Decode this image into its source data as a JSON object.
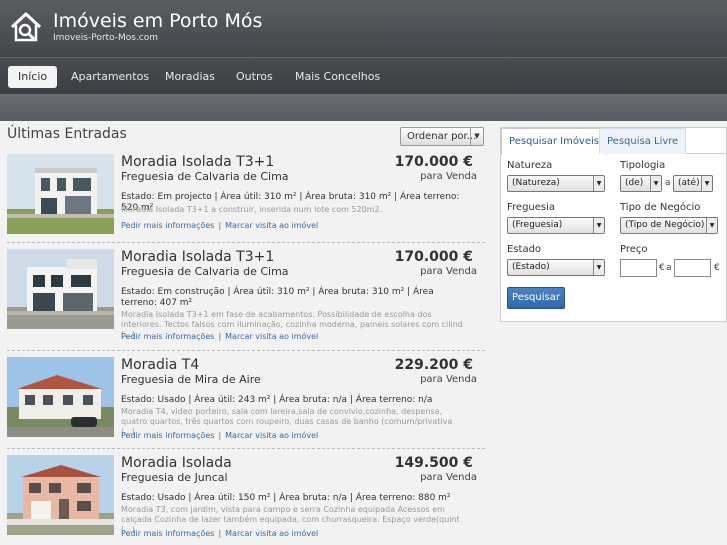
{
  "site": {
    "title": "Imóveis em Porto Mós",
    "subtitle": "Imoveis-Porto-Mos.com"
  },
  "nav": {
    "items": [
      "Início",
      "Apartamentos",
      "Moradias",
      "Outros",
      "Mais Concelhos"
    ]
  },
  "listing": {
    "title": "Últimas Entradas",
    "sort_label": "Ordenar por...",
    "items": [
      {
        "title": "Moradia Isolada  T3+1",
        "location": "Freguesia de Calvaria de Cima",
        "price": "170.000 €",
        "deal": "para Venda",
        "specs": "Estado: Em projecto  | Área útil: 310 m²  | Área bruta: 310 m²  | Área terreno: 520 m²",
        "desc": "Moradia Isolada T3+1 a construir, inserida num lote com 520m2.",
        "link_info": "Pedir mais informações",
        "link_visit": "Marcar visita ao imóvel"
      },
      {
        "title": "Moradia Isolada  T3+1",
        "location": "Freguesia de Calvaria de Cima",
        "price": "170.000 €",
        "deal": "para Venda",
        "specs": "Estado: Em construção  | Área útil: 310 m²  | Área bruta: 310 m²  | Área terreno: 407 m²",
        "desc": "Moradia Isolada T3+1 em fase de acabamentos. Possibilidade de escolha dos interiores. Tectos falsos com iluminação, cozinha moderna, paineis solares com cilind (...)",
        "link_info": "Pedir mais informações",
        "link_visit": "Marcar visita ao imóvel"
      },
      {
        "title": "Moradia  T4",
        "location": "Freguesia de Mira de Aire",
        "price": "229.200 €",
        "deal": "para Venda",
        "specs": "Estado: Usado  | Área útil: 243 m²  | Área bruta: n/a  | Área terreno: n/a",
        "desc": "Moradia T4, video porteiro, sala com lareira,sala de convivio,cozinha, despensa, quatro quartos, três quartos com roupeiro, duas casas de banho (comum/privativa (...)",
        "link_info": "Pedir mais informações",
        "link_visit": "Marcar visita ao imóvel"
      },
      {
        "title": "Moradia Isolada",
        "location": "Freguesia de Juncal",
        "price": "149.500 €",
        "deal": "para Venda",
        "specs": "Estado: Usado  | Área útil: 150 m²  | Área bruta: n/a  | Área terreno: 880 m²",
        "desc": "Moradia T3, com jardim, vista para campo e serra Cozinha equipada Acessos em calçada Cozinha de lazer também equipada, com churrasqueira. Espaço verde(quint (...)",
        "link_info": "Pedir mais informações",
        "link_visit": "Marcar visita ao imóvel"
      }
    ]
  },
  "search": {
    "tab_active": "Pesquisar Imóveis",
    "tab_other": "Pesquisa Livre",
    "natureza_label": "Natureza",
    "natureza_value": "(Natureza)",
    "tipologia_label": "Tipologia",
    "tipologia_from": "(de)",
    "tipologia_to": "(até)",
    "sep_a": "a",
    "freguesia_label": "Freguesia",
    "freguesia_value": "(Freguesia)",
    "negocio_label": "Tipo de Negócio",
    "negocio_value": "(Tipo de Negócio)",
    "estado_label": "Estado",
    "estado_value": "(Estado)",
    "preco_label": "Preço",
    "currency": "€",
    "button": "Pesquisar"
  }
}
